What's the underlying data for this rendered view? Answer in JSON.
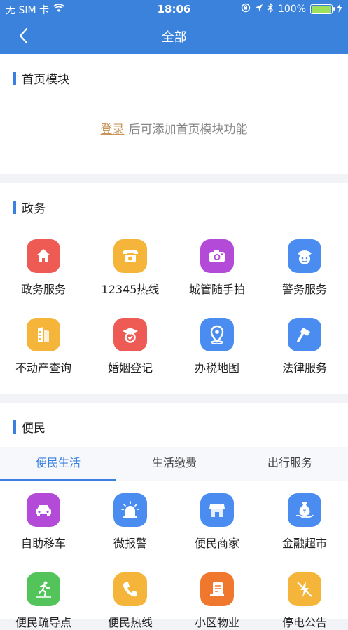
{
  "status": {
    "carrier": "无 SIM 卡",
    "time": "18:06",
    "battery": "100%",
    "battery_level": 1.0
  },
  "nav": {
    "title": "全部"
  },
  "home_module": {
    "title": "首页模块",
    "login_link": "登录",
    "hint": "后可添加首页模块功能"
  },
  "government": {
    "title": "政务",
    "items": [
      {
        "label": "政务服务",
        "icon": "home-icon",
        "color": "#ee5b55"
      },
      {
        "label": "12345热线",
        "icon": "telephone-icon",
        "color": "#f4b53a"
      },
      {
        "label": "城管随手拍",
        "icon": "camera-icon",
        "color": "#b44bd8"
      },
      {
        "label": "警务服务",
        "icon": "police-icon",
        "color": "#4a8cf0"
      },
      {
        "label": "不动产查询",
        "icon": "building-icon",
        "color": "#f4b53a"
      },
      {
        "label": "婚姻登记",
        "icon": "marriage-icon",
        "color": "#ee5b55"
      },
      {
        "label": "办税地图",
        "icon": "map-pin-icon",
        "color": "#4a8cf0"
      },
      {
        "label": "法律服务",
        "icon": "gavel-icon",
        "color": "#4a8cf0"
      }
    ]
  },
  "convenience": {
    "title": "便民",
    "tabs": [
      "便民生活",
      "生活缴费",
      "出行服务"
    ],
    "items": [
      {
        "label": "自助移车",
        "icon": "car-icon",
        "color": "#b44bd8"
      },
      {
        "label": "微报警",
        "icon": "alarm-icon",
        "color": "#4a8cf0"
      },
      {
        "label": "便民商家",
        "icon": "shop-icon",
        "color": "#4a8cf0"
      },
      {
        "label": "金融超市",
        "icon": "money-bag-icon",
        "color": "#4a8cf0"
      },
      {
        "label": "便民疏导点",
        "icon": "runner-icon",
        "color": "#52c45a"
      },
      {
        "label": "便民热线",
        "icon": "phone-icon",
        "color": "#f4b53a"
      },
      {
        "label": "小区物业",
        "icon": "document-icon",
        "color": "#f0782e"
      },
      {
        "label": "停电公告",
        "icon": "power-off-icon",
        "color": "#f4b53a"
      }
    ]
  }
}
